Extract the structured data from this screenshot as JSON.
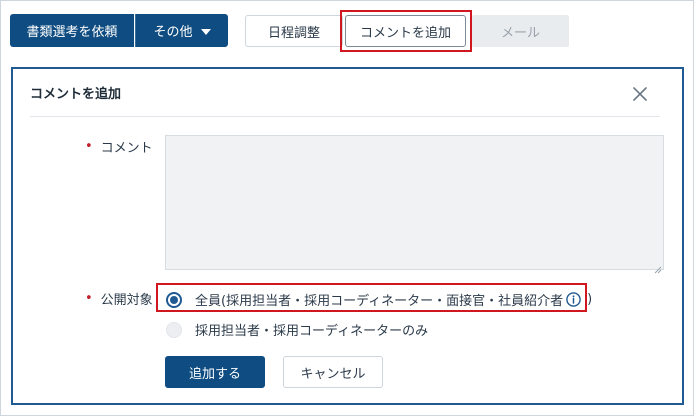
{
  "toolbar": {
    "request_screening_label": "書類選考を依頼",
    "other_label": "その他",
    "schedule_label": "日程調整",
    "add_comment_label": "コメントを追加",
    "mail_label": "メール"
  },
  "dialog": {
    "title": "コメントを追加",
    "close_icon": "close-icon",
    "comment_label": "コメント",
    "comment_value": "",
    "visibility_label": "公開対象",
    "visibility_options": [
      {
        "label": "全員(採用担当者・採用コーディネーター・面接官・社員紹介者",
        "suffix": ")",
        "selected": true
      },
      {
        "label": "採用担当者・採用コーディネーターのみ",
        "selected": false
      }
    ],
    "submit_label": "追加する",
    "cancel_label": "キャンセル"
  },
  "colors": {
    "primary": "#0f4c81",
    "highlight": "#d0171f",
    "required": "#c0202a"
  }
}
